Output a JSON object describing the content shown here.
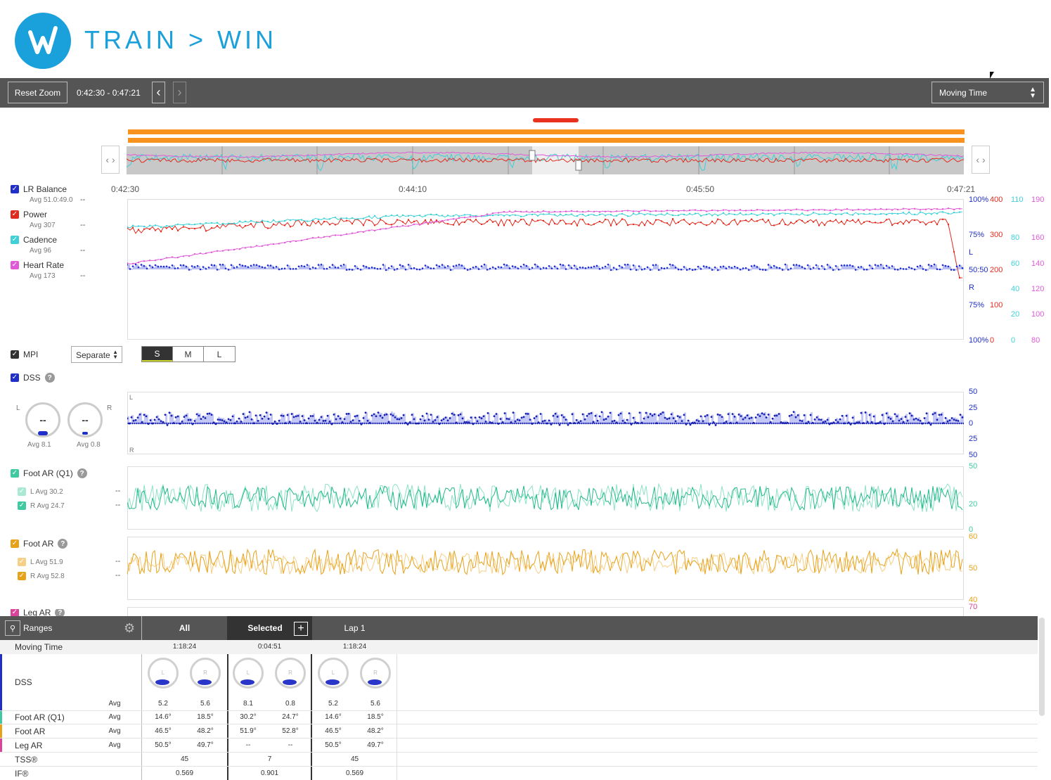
{
  "brand": {
    "name": "TRAIN > WIN",
    "mark": "W"
  },
  "toolbar": {
    "reset_zoom": "Reset Zoom",
    "range": "0:42:30 - 0:47:21",
    "prev": "‹",
    "next": "›",
    "time_mode": "Moving Time"
  },
  "overview": {
    "nav_left": "‹ ›",
    "nav_right": "‹ ›"
  },
  "time_axis": [
    "0:42:30",
    "0:44:10",
    "0:45:50",
    "0:47:21"
  ],
  "legend": [
    {
      "name": "LR Balance",
      "avg": "Avg 51.0:49.0",
      "value": "--",
      "color": "#1f2fc7"
    },
    {
      "name": "Power",
      "avg": "Avg 307",
      "value": "--",
      "color": "#e02b1f"
    },
    {
      "name": "Cadence",
      "avg": "Avg 96",
      "value": "--",
      "color": "#3fd0d8"
    },
    {
      "name": "Heart Rate",
      "avg": "Avg 173",
      "value": "--",
      "color": "#e05ad8"
    }
  ],
  "right_axes": {
    "balance": [
      "100%",
      "75%",
      "L",
      "50:50",
      "R",
      "75%",
      "100%"
    ],
    "power": [
      "400",
      "300",
      "200",
      "100",
      "0"
    ],
    "cadence": [
      "110",
      "80",
      "60",
      "40",
      "20",
      "0"
    ],
    "heart_rate": [
      "190",
      "160",
      "140",
      "120",
      "100",
      "80"
    ]
  },
  "mpi": {
    "label": "MPI",
    "mode": "Separate",
    "sizes": [
      "S",
      "M",
      "L"
    ],
    "active_size": "S"
  },
  "dss": {
    "label": "DSS",
    "help": "?",
    "gauge_left": {
      "side": "L",
      "value": "--",
      "avg": "Avg 8.1"
    },
    "gauge_right": {
      "side": "R",
      "value": "--",
      "avg": "Avg 0.8"
    },
    "axis": [
      "50",
      "25",
      "0",
      "25",
      "50"
    ],
    "plot_left": "L",
    "plot_right": "R"
  },
  "foot_ar_q1": {
    "label": "Foot AR (Q1)",
    "help": "?",
    "left": {
      "label": "L Avg 30.2",
      "value": "--"
    },
    "right": {
      "label": "R Avg 24.7",
      "value": "--"
    },
    "axis": [
      "50",
      "20",
      "0"
    ]
  },
  "foot_ar": {
    "label": "Foot AR",
    "help": "?",
    "left": {
      "label": "L Avg 51.9",
      "value": "--"
    },
    "right": {
      "label": "R Avg 52.8",
      "value": "--"
    },
    "axis": [
      "60",
      "50",
      "40"
    ]
  },
  "leg_ar": {
    "label": "Leg AR",
    "help": "?",
    "axis_top": "70"
  },
  "table": {
    "ranges_label": "Ranges",
    "columns": [
      "All",
      "Selected",
      "Lap 1"
    ],
    "add_icon": "+",
    "moving_time": {
      "label": "Moving Time",
      "values": [
        "1:18:24",
        "0:04:51",
        "1:18:24"
      ]
    },
    "dss": {
      "label": "DSS",
      "avg_label": "Avg",
      "values": [
        "5.2",
        "5.6",
        "8.1",
        "0.8",
        "5.2",
        "5.6"
      ],
      "gauge_sides": [
        "L",
        "R"
      ]
    },
    "rows": [
      {
        "label": "Foot AR (Q1)",
        "avg": "Avg",
        "values": [
          "14.6°",
          "18.5°",
          "30.2°",
          "24.7°",
          "14.6°",
          "18.5°"
        ],
        "color": "#3fc9a0"
      },
      {
        "label": "Foot AR",
        "avg": "Avg",
        "values": [
          "46.5°",
          "48.2°",
          "51.9°",
          "52.8°",
          "46.5°",
          "48.2°"
        ],
        "color": "#e8a21a"
      },
      {
        "label": "Leg AR",
        "avg": "Avg",
        "values": [
          "50.5°",
          "49.7°",
          "--",
          "--",
          "50.5°",
          "49.7°"
        ],
        "color": "#d9439a"
      }
    ],
    "tss": {
      "label": "TSS®",
      "values": [
        "45",
        "7",
        "45"
      ]
    },
    "if": {
      "label": "IF®",
      "values": [
        "0.569",
        "0.901",
        "0.569"
      ]
    }
  }
}
